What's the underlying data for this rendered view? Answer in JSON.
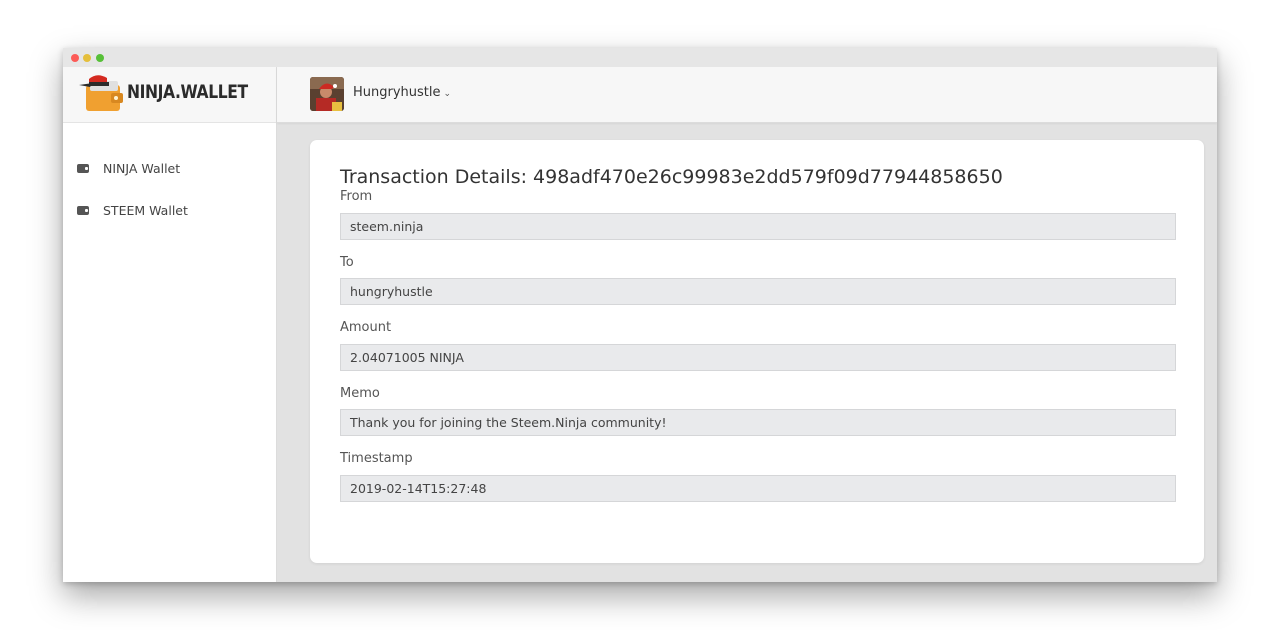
{
  "app": {
    "logo_text": "NINJA.WALLET"
  },
  "sidebar": {
    "items": [
      {
        "label": "NINJA Wallet",
        "icon": "wallet-icon"
      },
      {
        "label": "STEEM Wallet",
        "icon": "wallet-icon"
      }
    ]
  },
  "header": {
    "username": "Hungryhustle",
    "dropdown_glyph": "⌄"
  },
  "transaction": {
    "title": "Transaction Details: 498adf470e26c99983e2dd579f09d77944858650",
    "fields": [
      {
        "label": "From",
        "value": "steem.ninja"
      },
      {
        "label": "To",
        "value": "hungryhustle"
      },
      {
        "label": "Amount",
        "value": "2.04071005 NINJA"
      },
      {
        "label": "Memo",
        "value": "Thank you for joining the Steem.Ninja community!"
      },
      {
        "label": "Timestamp",
        "value": "2019-02-14T15:27:48"
      }
    ]
  },
  "colors": {
    "window_bg": "#e2e2e2",
    "panel_bg": "#f7f7f7",
    "card_bg": "#ffffff",
    "field_bg": "#e9eaec",
    "logo_orange": "#f0a030",
    "logo_red": "#d42a20"
  }
}
